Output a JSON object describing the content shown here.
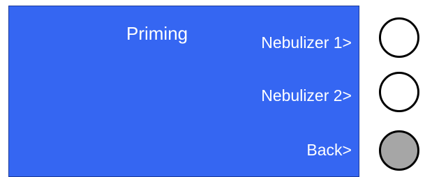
{
  "screen": {
    "title": "Priming",
    "background_color": "#3566f2",
    "text_color": "#ffffff"
  },
  "menu": {
    "options": [
      {
        "label": "Nebulizer 1>"
      },
      {
        "label": "Nebulizer 2>"
      },
      {
        "label": "Back>"
      }
    ]
  },
  "hardware_buttons": [
    {
      "icon": "circle-button-icon",
      "state": "unpressed",
      "fill_color": "#ffffff"
    },
    {
      "icon": "circle-button-icon",
      "state": "unpressed",
      "fill_color": "#ffffff"
    },
    {
      "icon": "circle-button-icon",
      "state": "pressed",
      "fill_color": "#a6a6a6"
    }
  ]
}
